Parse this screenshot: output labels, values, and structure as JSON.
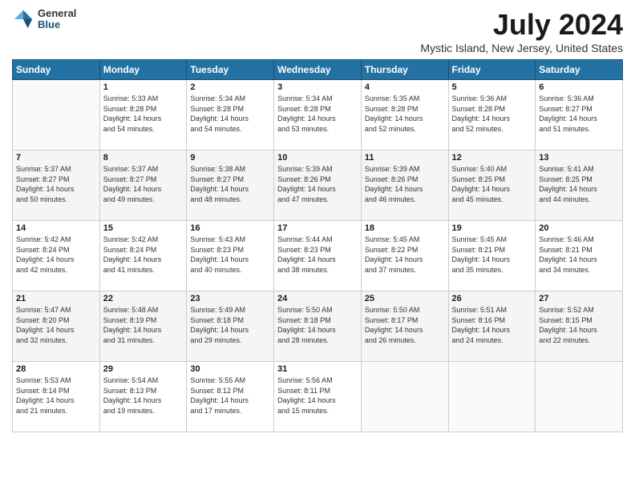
{
  "logo": {
    "general": "General",
    "blue": "Blue"
  },
  "title": "July 2024",
  "subtitle": "Mystic Island, New Jersey, United States",
  "days_header": [
    "Sunday",
    "Monday",
    "Tuesday",
    "Wednesday",
    "Thursday",
    "Friday",
    "Saturday"
  ],
  "weeks": [
    [
      {
        "day": "",
        "info": ""
      },
      {
        "day": "1",
        "info": "Sunrise: 5:33 AM\nSunset: 8:28 PM\nDaylight: 14 hours\nand 54 minutes."
      },
      {
        "day": "2",
        "info": "Sunrise: 5:34 AM\nSunset: 8:28 PM\nDaylight: 14 hours\nand 54 minutes."
      },
      {
        "day": "3",
        "info": "Sunrise: 5:34 AM\nSunset: 8:28 PM\nDaylight: 14 hours\nand 53 minutes."
      },
      {
        "day": "4",
        "info": "Sunrise: 5:35 AM\nSunset: 8:28 PM\nDaylight: 14 hours\nand 52 minutes."
      },
      {
        "day": "5",
        "info": "Sunrise: 5:36 AM\nSunset: 8:28 PM\nDaylight: 14 hours\nand 52 minutes."
      },
      {
        "day": "6",
        "info": "Sunrise: 5:36 AM\nSunset: 8:27 PM\nDaylight: 14 hours\nand 51 minutes."
      }
    ],
    [
      {
        "day": "7",
        "info": "Sunrise: 5:37 AM\nSunset: 8:27 PM\nDaylight: 14 hours\nand 50 minutes."
      },
      {
        "day": "8",
        "info": "Sunrise: 5:37 AM\nSunset: 8:27 PM\nDaylight: 14 hours\nand 49 minutes."
      },
      {
        "day": "9",
        "info": "Sunrise: 5:38 AM\nSunset: 8:27 PM\nDaylight: 14 hours\nand 48 minutes."
      },
      {
        "day": "10",
        "info": "Sunrise: 5:39 AM\nSunset: 8:26 PM\nDaylight: 14 hours\nand 47 minutes."
      },
      {
        "day": "11",
        "info": "Sunrise: 5:39 AM\nSunset: 8:26 PM\nDaylight: 14 hours\nand 46 minutes."
      },
      {
        "day": "12",
        "info": "Sunrise: 5:40 AM\nSunset: 8:25 PM\nDaylight: 14 hours\nand 45 minutes."
      },
      {
        "day": "13",
        "info": "Sunrise: 5:41 AM\nSunset: 8:25 PM\nDaylight: 14 hours\nand 44 minutes."
      }
    ],
    [
      {
        "day": "14",
        "info": "Sunrise: 5:42 AM\nSunset: 8:24 PM\nDaylight: 14 hours\nand 42 minutes."
      },
      {
        "day": "15",
        "info": "Sunrise: 5:42 AM\nSunset: 8:24 PM\nDaylight: 14 hours\nand 41 minutes."
      },
      {
        "day": "16",
        "info": "Sunrise: 5:43 AM\nSunset: 8:23 PM\nDaylight: 14 hours\nand 40 minutes."
      },
      {
        "day": "17",
        "info": "Sunrise: 5:44 AM\nSunset: 8:23 PM\nDaylight: 14 hours\nand 38 minutes."
      },
      {
        "day": "18",
        "info": "Sunrise: 5:45 AM\nSunset: 8:22 PM\nDaylight: 14 hours\nand 37 minutes."
      },
      {
        "day": "19",
        "info": "Sunrise: 5:45 AM\nSunset: 8:21 PM\nDaylight: 14 hours\nand 35 minutes."
      },
      {
        "day": "20",
        "info": "Sunrise: 5:46 AM\nSunset: 8:21 PM\nDaylight: 14 hours\nand 34 minutes."
      }
    ],
    [
      {
        "day": "21",
        "info": "Sunrise: 5:47 AM\nSunset: 8:20 PM\nDaylight: 14 hours\nand 32 minutes."
      },
      {
        "day": "22",
        "info": "Sunrise: 5:48 AM\nSunset: 8:19 PM\nDaylight: 14 hours\nand 31 minutes."
      },
      {
        "day": "23",
        "info": "Sunrise: 5:49 AM\nSunset: 8:18 PM\nDaylight: 14 hours\nand 29 minutes."
      },
      {
        "day": "24",
        "info": "Sunrise: 5:50 AM\nSunset: 8:18 PM\nDaylight: 14 hours\nand 28 minutes."
      },
      {
        "day": "25",
        "info": "Sunrise: 5:50 AM\nSunset: 8:17 PM\nDaylight: 14 hours\nand 26 minutes."
      },
      {
        "day": "26",
        "info": "Sunrise: 5:51 AM\nSunset: 8:16 PM\nDaylight: 14 hours\nand 24 minutes."
      },
      {
        "day": "27",
        "info": "Sunrise: 5:52 AM\nSunset: 8:15 PM\nDaylight: 14 hours\nand 22 minutes."
      }
    ],
    [
      {
        "day": "28",
        "info": "Sunrise: 5:53 AM\nSunset: 8:14 PM\nDaylight: 14 hours\nand 21 minutes."
      },
      {
        "day": "29",
        "info": "Sunrise: 5:54 AM\nSunset: 8:13 PM\nDaylight: 14 hours\nand 19 minutes."
      },
      {
        "day": "30",
        "info": "Sunrise: 5:55 AM\nSunset: 8:12 PM\nDaylight: 14 hours\nand 17 minutes."
      },
      {
        "day": "31",
        "info": "Sunrise: 5:56 AM\nSunset: 8:11 PM\nDaylight: 14 hours\nand 15 minutes."
      },
      {
        "day": "",
        "info": ""
      },
      {
        "day": "",
        "info": ""
      },
      {
        "day": "",
        "info": ""
      }
    ]
  ]
}
